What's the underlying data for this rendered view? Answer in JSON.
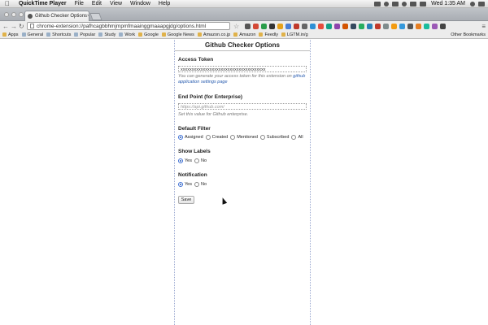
{
  "menubar": {
    "app_name": "QuickTime Player",
    "items": [
      "File",
      "Edit",
      "View",
      "Window",
      "Help"
    ],
    "clock": "Wed 1:35 AM"
  },
  "browser": {
    "tab_title": "Github Checker Options",
    "url": "chrome-extension://pafhcagbbhmjmpmfmaainggmaaapgjdg/options.html",
    "bookmarks": [
      "Apps",
      "General",
      "Shortcuts",
      "Popular",
      "Study",
      "Work",
      "Google",
      "Google News",
      "Amazon.co.jp",
      "Amazon",
      "Feedly",
      "LGTM.in/g"
    ],
    "other_bookmarks": "Other Bookmarks"
  },
  "page": {
    "title": "Github Checker Options",
    "access_token": {
      "label": "Access Token",
      "value": "xxxxxxxxxxxxxxxxxxxxxxxxxxxxxxxxxxxxxx",
      "hint_prefix": "You can generate your access token for this extension on",
      "hint_link": "github application settings page"
    },
    "end_point": {
      "label": "End Point (for Enterprise)",
      "placeholder": "https://api.github.com/",
      "hint": "Set this value for Github enterprise."
    },
    "default_filter": {
      "label": "Default Filter",
      "options": [
        "Assigned",
        "Created",
        "Mentioned",
        "Subscribed",
        "All"
      ],
      "selected": "Assigned"
    },
    "show_labels": {
      "label": "Show Labels",
      "options": [
        "Yes",
        "No"
      ],
      "selected": "Yes"
    },
    "notification": {
      "label": "Notification",
      "options": [
        "Yes",
        "No"
      ],
      "selected": "Yes"
    },
    "save_label": "Save"
  },
  "colors": {
    "accent": "#2a5db0",
    "panel_border": "#9aa8d0"
  }
}
